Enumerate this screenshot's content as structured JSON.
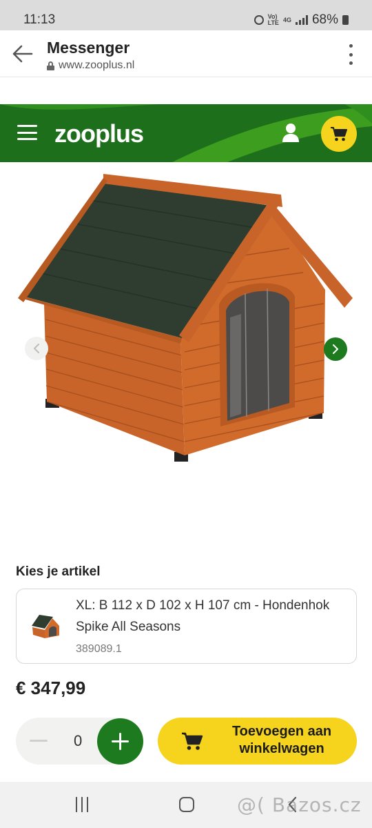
{
  "status_bar": {
    "time": "11:13",
    "network_top": "Vo)",
    "network_bottom": "LTE",
    "signal_top": "4G",
    "battery_percent": "68%"
  },
  "browser": {
    "title": "Messenger",
    "url": "www.zooplus.nl"
  },
  "site_header": {
    "logo_text": "zooplus",
    "colors": {
      "green": "#1d6f1c",
      "accent_yellow": "#f6d31c"
    }
  },
  "product": {
    "choose_label": "Kies je artikel",
    "article_title": "XL: B 112 x D 102 x H 107 cm - Hondenhok Spike All Seasons",
    "article_sku": "389089.1",
    "price": "€ 347,99",
    "quantity": "0",
    "add_to_cart_label": "Toevoegen aan winkelwagen"
  },
  "watermark": "@( Bazos.cz",
  "icons": {
    "back": "back-arrow-icon",
    "lock": "lock-icon",
    "menu": "kebab-menu-icon",
    "hamburger": "hamburger-icon",
    "user": "user-icon",
    "cart": "cart-icon",
    "prev": "chevron-left-icon",
    "next": "chevron-right-icon"
  }
}
